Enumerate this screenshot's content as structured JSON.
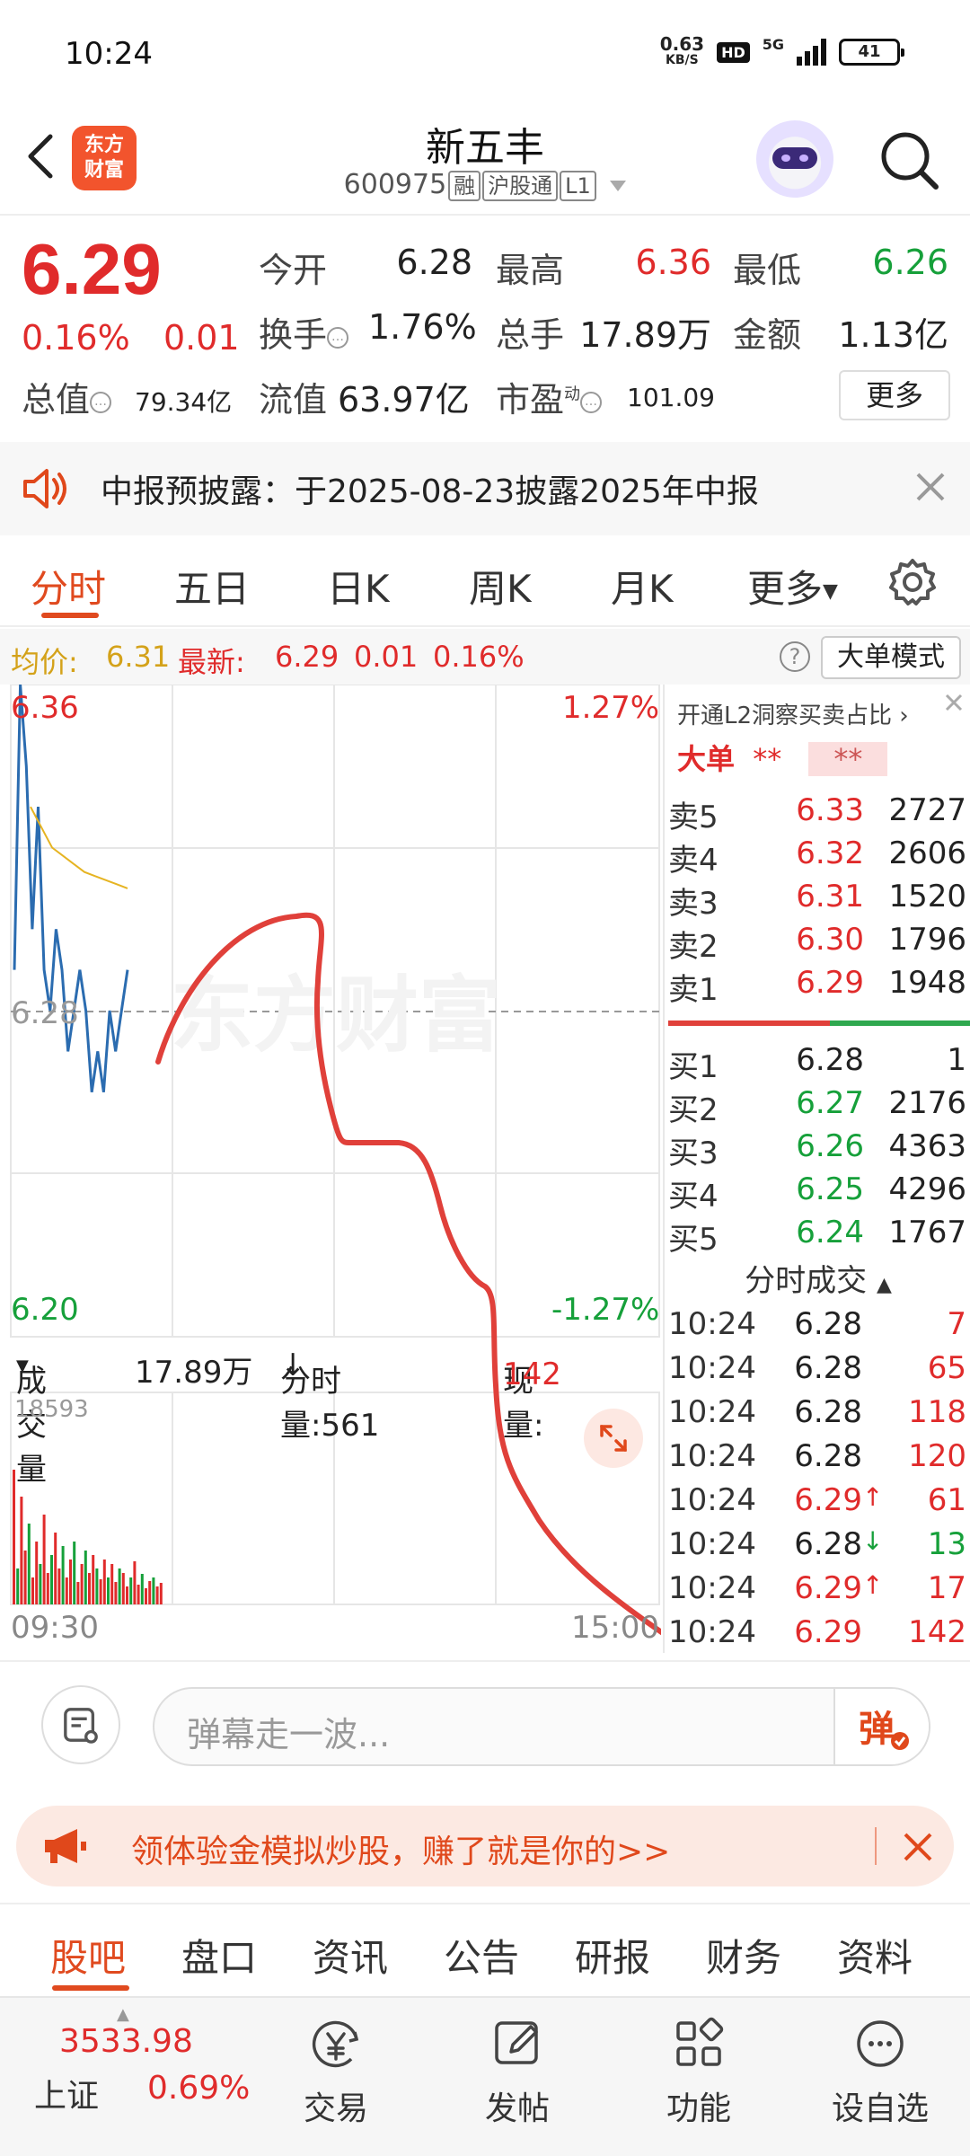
{
  "status": {
    "time": "10:24",
    "net_speed": "0.63",
    "net_unit": "KB/S",
    "hd": "HD",
    "network": "5G",
    "battery": "41"
  },
  "header": {
    "brand_line1": "东方",
    "brand_line2": "财富",
    "name": "新五丰",
    "code": "600975",
    "tags": [
      "融",
      "沪股通",
      "L1"
    ]
  },
  "quote": {
    "price": "6.29",
    "change_pct": "0.16%",
    "change_amt": "0.01",
    "open_label": "今开",
    "open": "6.28",
    "high_label": "最高",
    "high": "6.36",
    "low_label": "最低",
    "low": "6.26",
    "turnover_label": "换手",
    "turnover": "1.76%",
    "volume_label": "总手",
    "volume": "17.89万",
    "amount_label": "金额",
    "amount": "1.13亿",
    "mktcap_label": "总值",
    "mktcap": "79.34亿",
    "float_label": "流值",
    "float_cap": "63.97亿",
    "pe_label": "市盈",
    "pe_sup": "动",
    "pe": "101.09",
    "more": "更多"
  },
  "notice": {
    "text": "中报预披露：于2025-08-23披露2025年中报"
  },
  "chart_tabs": [
    "分时",
    "五日",
    "日K",
    "周K",
    "月K",
    "更多"
  ],
  "avg_row": {
    "avg_label": "均价:",
    "avg": "6.31",
    "latest_label": "最新:",
    "latest": "6.29",
    "chg": "0.01",
    "pct": "0.16%",
    "big_mode": "大单模式"
  },
  "chart": {
    "y_max": "6.36",
    "y_pct_max": "1.27%",
    "y_ref": "6.28",
    "y_min": "6.20",
    "y_pct_min": "-1.27%",
    "vol_label": "成交量",
    "vol_total": "17.89万",
    "tick_vol": "分时量:561",
    "cur_vol_label": "现量:",
    "cur_vol": "142",
    "vol_max": "18593",
    "x_start": "09:30",
    "x_end": "15:00",
    "watermark": "东方财富"
  },
  "chart_data": {
    "type": "line",
    "ylim": [
      6.2,
      6.36
    ],
    "reference": 6.28,
    "x_range": [
      "09:30",
      "15:00"
    ],
    "series": [
      {
        "values": [
          6.29,
          6.36,
          6.34,
          6.3,
          6.33,
          6.29,
          6.28,
          6.3,
          6.29,
          6.27,
          6.28,
          6.29,
          6.28,
          6.26,
          6.27,
          6.26,
          6.28,
          6.27,
          6.28,
          6.29
        ]
      },
      {
        "values": [
          6.33,
          6.325,
          6.32,
          6.318,
          6.316,
          6.314,
          6.313,
          6.312,
          6.311,
          6.31
        ]
      }
    ],
    "volume_max": 18593
  },
  "orderbook": {
    "l2_banner": "开通L2洞察买卖占比",
    "big_label": "大单",
    "big_a": "**",
    "big_b": "**",
    "asks": [
      {
        "label": "卖5",
        "price": "6.33",
        "vol": "2727"
      },
      {
        "label": "卖4",
        "price": "6.32",
        "vol": "2606"
      },
      {
        "label": "卖3",
        "price": "6.31",
        "vol": "1520"
      },
      {
        "label": "卖2",
        "price": "6.30",
        "vol": "1796"
      },
      {
        "label": "卖1",
        "price": "6.29",
        "vol": "1948"
      }
    ],
    "bids": [
      {
        "label": "买1",
        "price": "6.28",
        "vol": "1"
      },
      {
        "label": "买2",
        "price": "6.27",
        "vol": "2176"
      },
      {
        "label": "买3",
        "price": "6.26",
        "vol": "4363"
      },
      {
        "label": "买4",
        "price": "6.25",
        "vol": "4296"
      },
      {
        "label": "买5",
        "price": "6.24",
        "vol": "1767"
      }
    ],
    "ticks_header": "分时成交",
    "ticks": [
      {
        "time": "10:24",
        "price": "6.28",
        "arrow": "",
        "vol": "7"
      },
      {
        "time": "10:24",
        "price": "6.28",
        "arrow": "",
        "vol": "65"
      },
      {
        "time": "10:24",
        "price": "6.28",
        "arrow": "",
        "vol": "118"
      },
      {
        "time": "10:24",
        "price": "6.28",
        "arrow": "",
        "vol": "120"
      },
      {
        "time": "10:24",
        "price": "6.29",
        "arrow": "↑",
        "vol": "61"
      },
      {
        "time": "10:24",
        "price": "6.28",
        "arrow": "↓",
        "vol": "13"
      },
      {
        "time": "10:24",
        "price": "6.29",
        "arrow": "↑",
        "vol": "17"
      },
      {
        "time": "10:24",
        "price": "6.29",
        "arrow": "",
        "vol": "142"
      }
    ]
  },
  "barrage": {
    "placeholder": "弹幕走一波..."
  },
  "promo": {
    "text": "领体验金模拟炒股，赚了就是你的>>"
  },
  "bottom_tabs": [
    "股吧",
    "盘口",
    "资讯",
    "公告",
    "研报",
    "财务",
    "资料"
  ],
  "nav": {
    "index_val": "3533.98",
    "index_name": "上证",
    "index_pct": "0.69%",
    "items": [
      "交易",
      "发帖",
      "功能",
      "设自选"
    ]
  },
  "colors": {
    "up": "#e02b2b",
    "down": "#16a03a",
    "accent": "#e04a1f",
    "price_line": "#2b6cb0",
    "avg_line": "#e6b422"
  }
}
